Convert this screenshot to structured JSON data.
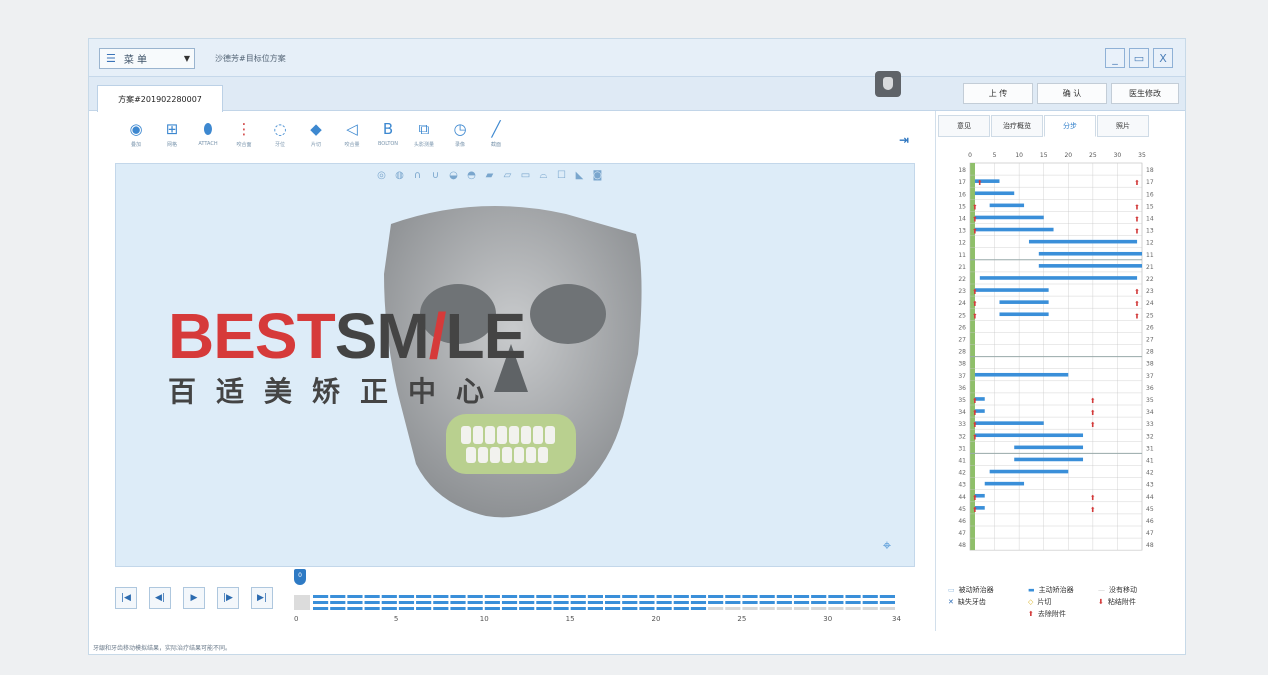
{
  "window": {
    "menu_label": "菜 单",
    "title": "沙德芳#目标位方案",
    "plan_tab": "方案#201902280007",
    "controls": [
      "_",
      "▭",
      "X"
    ]
  },
  "top_buttons": [
    "上 传",
    "确 认",
    "医生修改"
  ],
  "toolbar": {
    "tools": [
      {
        "icon": "overlay-icon",
        "label": "叠加"
      },
      {
        "icon": "grid-icon",
        "label": "网格"
      },
      {
        "icon": "attach-icon",
        "label": "ATTACH"
      },
      {
        "icon": "occlusion-icon",
        "label": "咬合面"
      },
      {
        "icon": "tooth-icon",
        "label": "牙位"
      },
      {
        "icon": "ipr-icon",
        "label": "片切"
      },
      {
        "icon": "bite-icon",
        "label": "咬合量"
      },
      {
        "icon": "bolton-icon",
        "label": "BOLTON"
      },
      {
        "icon": "measure-icon",
        "label": "头影测量"
      },
      {
        "icon": "replay-icon",
        "label": "录像"
      },
      {
        "icon": "section-icon",
        "label": "截面"
      }
    ]
  },
  "logo": {
    "text_red_1": "BEST",
    "text_dark": "SM",
    "text_red_2": "/",
    "text_dark_2": "LE",
    "subtitle": "百适美矫正中心"
  },
  "playback": {
    "current_step": "0",
    "ticks": [
      "0",
      "5",
      "10",
      "15",
      "20",
      "25",
      "30",
      "34"
    ],
    "total_steps": 34
  },
  "right_tabs": [
    {
      "label": "意见",
      "active": false
    },
    {
      "label": "治疗概览",
      "active": false
    },
    {
      "label": "分步",
      "active": true
    },
    {
      "label": "照片",
      "active": false
    }
  ],
  "step_chart": {
    "x_ticks": [
      "0",
      "5",
      "10",
      "15",
      "20",
      "25",
      "30",
      "35"
    ],
    "upper_rows": [
      "18",
      "17",
      "16",
      "15",
      "14",
      "13",
      "12",
      "11",
      "21",
      "22",
      "23",
      "24",
      "25",
      "26",
      "27",
      "28"
    ],
    "lower_rows": [
      "38",
      "37",
      "36",
      "35",
      "34",
      "33",
      "32",
      "31",
      "41",
      "42",
      "43",
      "44",
      "45",
      "46",
      "47",
      "48"
    ],
    "colors": {
      "bar": "#3a8fd9",
      "grid": "#c9c9c9",
      "marker": "#d23a3a",
      "green": "#8fbf6a"
    }
  },
  "chart_data": {
    "type": "bar",
    "title": "",
    "xlabel": "",
    "ylabel": "",
    "xlim": [
      0,
      35
    ],
    "categories": [
      "18",
      "17",
      "16",
      "15",
      "14",
      "13",
      "12",
      "11",
      "21",
      "22",
      "23",
      "24",
      "25",
      "26",
      "27",
      "28",
      "38",
      "37",
      "36",
      "35",
      "34",
      "33",
      "32",
      "31",
      "41",
      "42",
      "43",
      "44",
      "45",
      "46",
      "47",
      "48"
    ],
    "series": [
      {
        "values": [
          [
            0,
            0
          ],
          [
            1,
            6
          ],
          [
            1,
            9
          ],
          [
            4,
            11
          ],
          [
            1,
            15
          ],
          [
            1,
            17
          ],
          [
            12,
            34
          ],
          [
            14,
            35
          ],
          [
            14,
            35
          ],
          [
            2,
            34
          ],
          [
            1,
            16
          ],
          [
            6,
            16
          ],
          [
            6,
            16
          ],
          [
            0,
            0
          ],
          [
            0,
            0
          ],
          [
            0,
            0
          ],
          [
            0,
            0
          ],
          [
            1,
            20
          ],
          [
            0,
            0
          ],
          [
            1,
            3
          ],
          [
            1,
            3
          ],
          [
            1,
            15
          ],
          [
            1,
            23
          ],
          [
            9,
            23
          ],
          [
            9,
            23
          ],
          [
            4,
            20
          ],
          [
            3,
            11
          ],
          [
            1,
            3
          ],
          [
            1,
            3
          ],
          [
            0,
            0
          ],
          [
            0,
            0
          ],
          [
            0,
            0
          ]
        ]
      }
    ]
  },
  "legend": [
    {
      "icon": "passive-aligner-icon",
      "label": "被动矫治器"
    },
    {
      "icon": "active-aligner-icon",
      "label": "主动矫治器"
    },
    {
      "icon": "no-move-icon",
      "label": "没有移动"
    },
    {
      "icon": "missing-tooth-icon",
      "label": "缺失牙齿"
    },
    {
      "icon": "ipr-legend-icon",
      "label": "片切"
    },
    {
      "icon": "bond-icon",
      "label": "粘结附件"
    },
    {
      "icon": "remove-attach-icon",
      "label": "去除附件"
    }
  ],
  "status_text": "牙龈和牙齿移动模拟结果，实际治疗结果可能不同。"
}
